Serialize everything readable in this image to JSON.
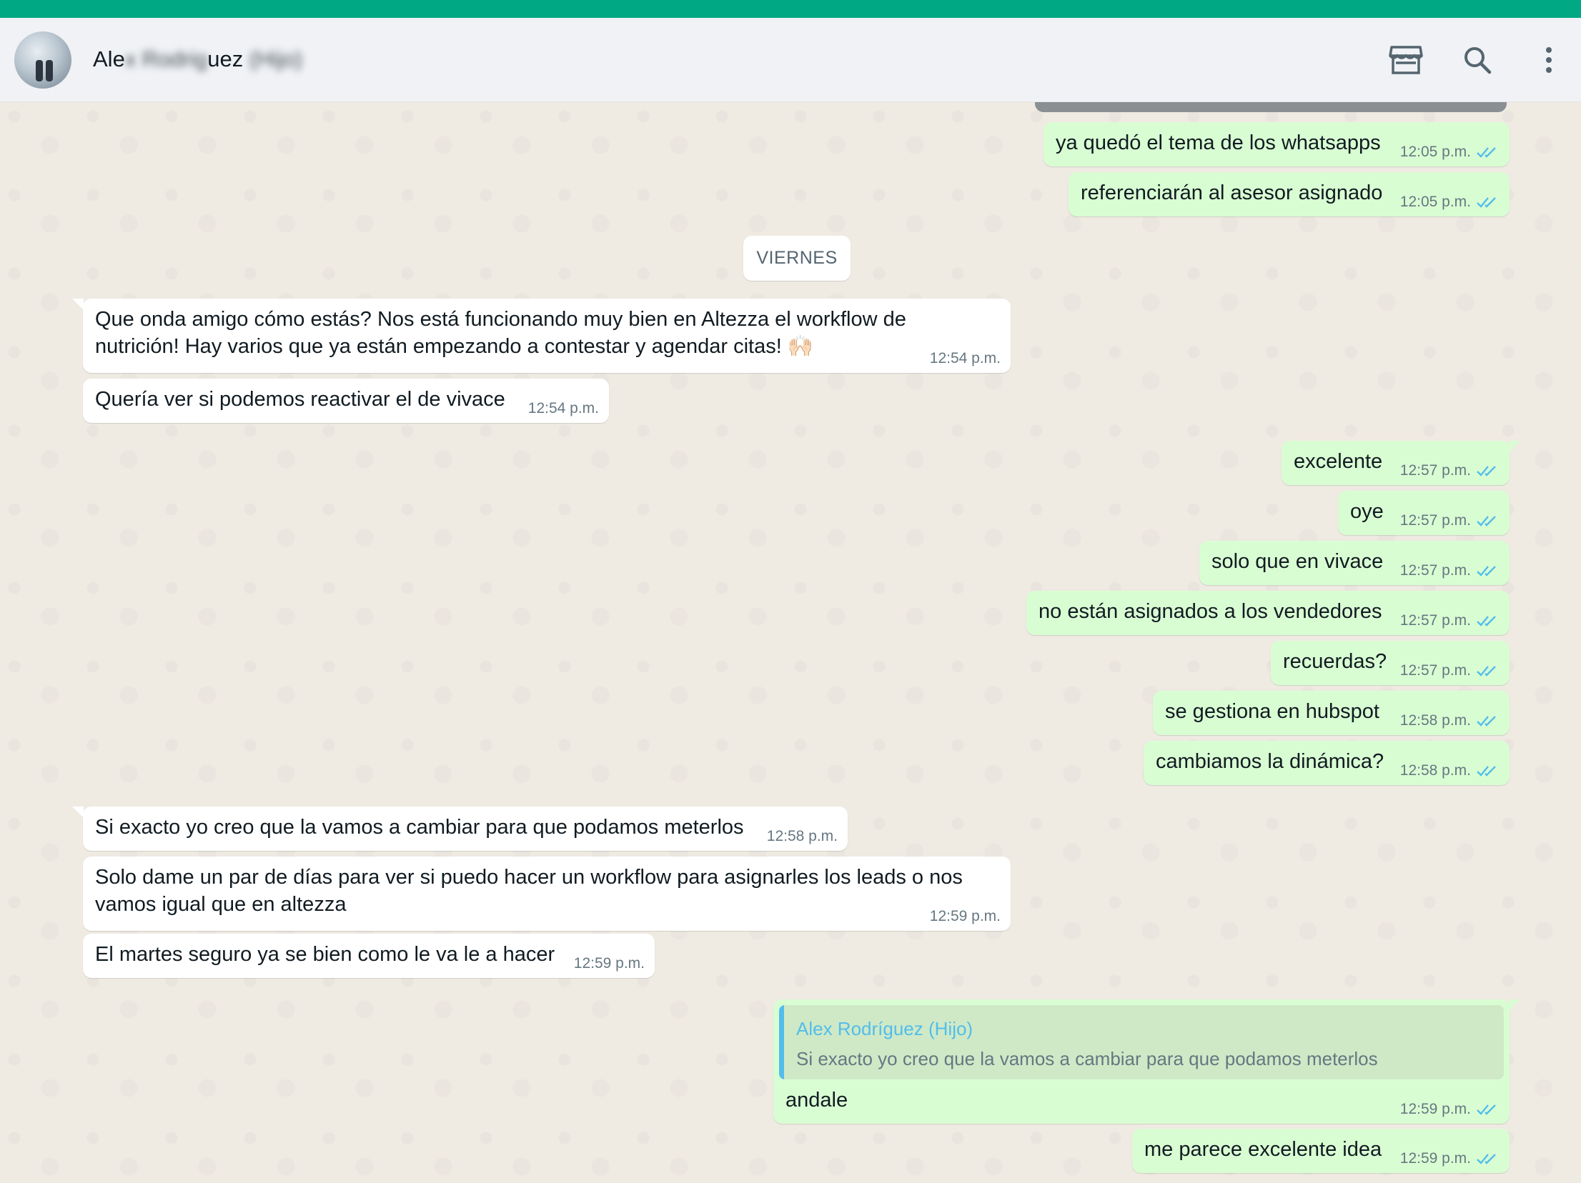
{
  "header": {
    "contact_name_visible_start": "Ale",
    "contact_name_blurred_1": "x Rodrig",
    "contact_name_visible_end": "uez",
    "contact_name_blurred_2": "(Hijo)",
    "icons": [
      "catalog-icon",
      "search-icon",
      "menu-icon"
    ]
  },
  "colors": {
    "accent": "#00a884",
    "incoming_bubble": "#ffffff",
    "outgoing_bubble": "#d9fdd3",
    "read_ticks": "#53bdeb",
    "chat_background": "#efeae2"
  },
  "day_separator": "VIERNES",
  "messages": [
    {
      "dir": "out",
      "text": "ya quedó el tema de los whatsapps",
      "time": "12:05 p.m.",
      "status": "read"
    },
    {
      "dir": "out",
      "text": "referenciarán al asesor asignado",
      "time": "12:05 p.m.",
      "status": "read"
    },
    {
      "dir": "in",
      "text": "Que onda amigo cómo estás? Nos está funcionando muy bien en Altezza el workflow de",
      "text2": "nutrición! Hay varios que ya están empezando a contestar y agendar citas! 🙌🏻",
      "time": "12:54 p.m."
    },
    {
      "dir": "in",
      "text": "Quería ver si podemos reactivar el de vivace",
      "time": "12:54 p.m."
    },
    {
      "dir": "out",
      "text": "excelente",
      "time": "12:57 p.m.",
      "status": "read"
    },
    {
      "dir": "out",
      "text": "oye",
      "time": "12:57 p.m.",
      "status": "read"
    },
    {
      "dir": "out",
      "text": "solo que en vivace",
      "time": "12:57 p.m.",
      "status": "read"
    },
    {
      "dir": "out",
      "text": "no están asignados a los vendedores",
      "time": "12:57 p.m.",
      "status": "read"
    },
    {
      "dir": "out",
      "text": "recuerdas?",
      "time": "12:57 p.m.",
      "status": "read"
    },
    {
      "dir": "out",
      "text": "se gestiona en hubspot",
      "time": "12:58 p.m.",
      "status": "read"
    },
    {
      "dir": "out",
      "text": "cambiamos la dinámica?",
      "time": "12:58 p.m.",
      "status": "read"
    },
    {
      "dir": "in",
      "text": "Si exacto yo creo que la vamos a cambiar para que podamos meterlos",
      "time": "12:58 p.m."
    },
    {
      "dir": "in",
      "text": "Solo dame un par de días para ver si puedo hacer un workflow para asignarles los leads o nos",
      "text2": "vamos igual que en altezza",
      "time": "12:59 p.m."
    },
    {
      "dir": "in",
      "text": "El martes seguro ya se bien como le va le a hacer",
      "time": "12:59 p.m."
    },
    {
      "dir": "out",
      "quote_name": "Alex Rodríguez (Hijo)",
      "quote_text": "Si exacto yo creo que la vamos a cambiar para que podamos meterlos",
      "text": "andale",
      "time": "12:59 p.m.",
      "status": "read"
    },
    {
      "dir": "out",
      "text": "me parece excelente idea",
      "time": "12:59 p.m.",
      "status": "read"
    }
  ]
}
